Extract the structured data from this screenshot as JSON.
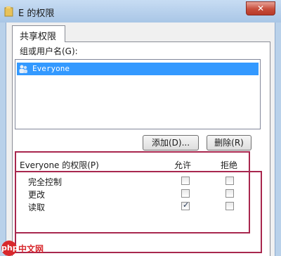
{
  "window": {
    "title": "E 的权限",
    "close_symbol": "✕"
  },
  "tabs": [
    {
      "label": "共享权限",
      "selected": true
    }
  ],
  "users_section": {
    "label": "组或用户名(G):",
    "items": [
      {
        "name": "Everyone",
        "selected": true,
        "icon": "users-group-icon"
      }
    ]
  },
  "buttons": {
    "add": "添加(D)...",
    "remove": "删除(R)"
  },
  "permissions": {
    "title": "Everyone 的权限(P)",
    "col_allow": "允许",
    "col_deny": "拒绝",
    "rows": [
      {
        "label": "完全控制",
        "allow": false,
        "deny": false
      },
      {
        "label": "更改",
        "allow": false,
        "deny": false
      },
      {
        "label": "读取",
        "allow": true,
        "deny": false
      }
    ]
  },
  "watermark": {
    "badge": "php",
    "text": "中文网"
  },
  "colors": {
    "selection": "#3399ff",
    "highlight_border": "#a8274e",
    "close_button": "#c74d3b",
    "watermark": "#d8282c"
  }
}
